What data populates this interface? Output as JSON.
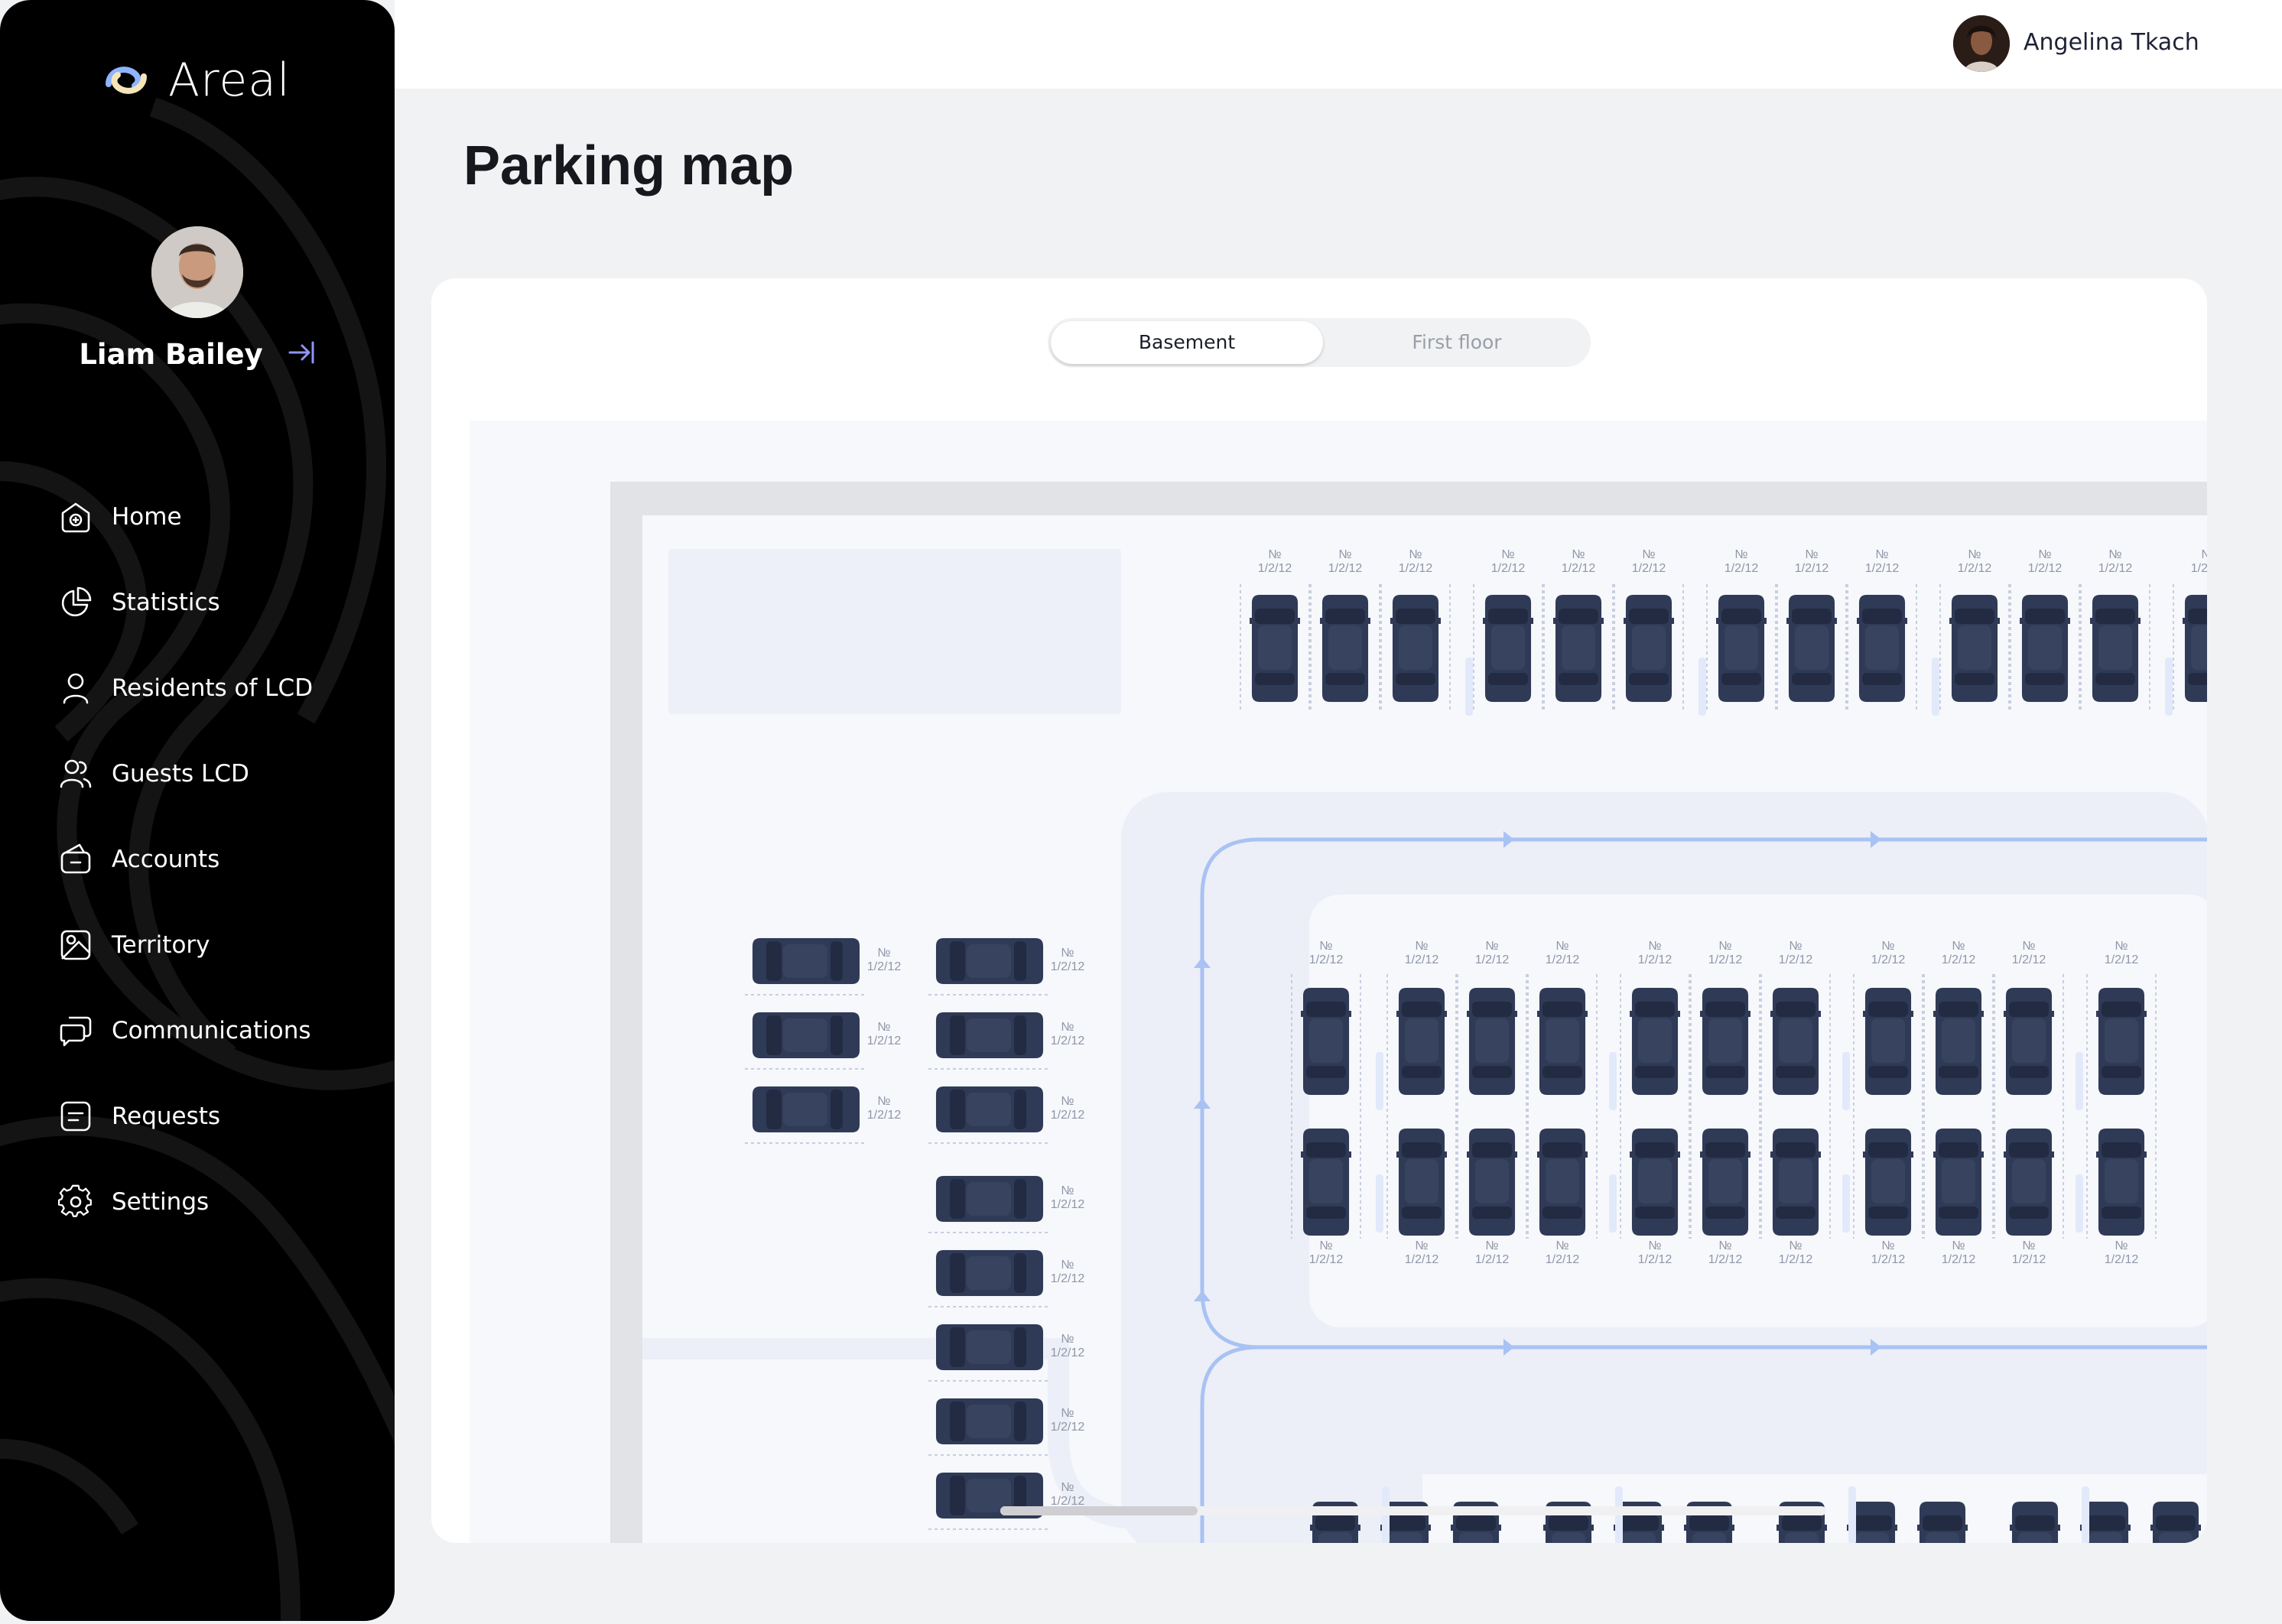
{
  "app": {
    "name": "Areal"
  },
  "sidebar": {
    "user_name": "Liam Bailey",
    "items": [
      {
        "label": "Home",
        "icon": "home-icon"
      },
      {
        "label": "Statistics",
        "icon": "pie-chart-icon"
      },
      {
        "label": "Residents of LCD",
        "icon": "user-icon"
      },
      {
        "label": "Guests LCD",
        "icon": "users-icon"
      },
      {
        "label": "Accounts",
        "icon": "wallet-icon"
      },
      {
        "label": "Territory",
        "icon": "map-icon"
      },
      {
        "label": "Communications",
        "icon": "chat-icon"
      },
      {
        "label": "Requests",
        "icon": "document-icon"
      },
      {
        "label": "Settings",
        "icon": "gear-icon"
      }
    ]
  },
  "header": {
    "user_name": "Angelina Tkach"
  },
  "page": {
    "title": "Parking map"
  },
  "floor_tabs": {
    "options": [
      "Basement",
      "First floor"
    ],
    "selected": "Basement"
  },
  "parking": {
    "spot_number_label": "№",
    "spot_id_label": "1/2/12"
  },
  "colors": {
    "car": "#2f3a56",
    "route": "#a9c2f4",
    "sidebar": "#000000",
    "accent": "#7b7ff0"
  }
}
